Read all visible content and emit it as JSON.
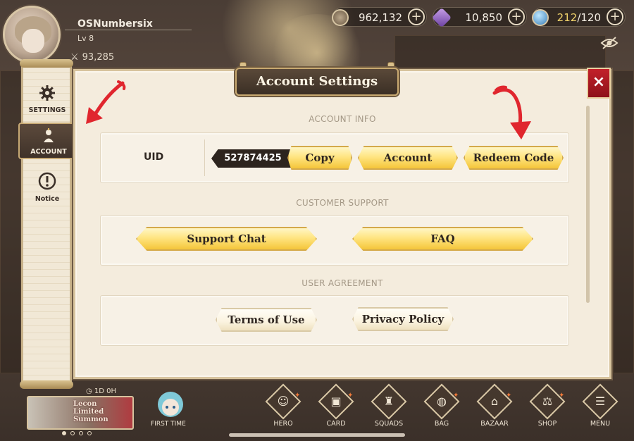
{
  "player": {
    "name": "OSNumbersix",
    "level": "Lv 8",
    "power": "93,285"
  },
  "currencies": {
    "gold": "962,132",
    "gems": "10,850",
    "stamina_current": "212",
    "stamina_max": "/120"
  },
  "sidebar": {
    "tabs": [
      {
        "label": "SETTINGS",
        "icon": "gear-icon"
      },
      {
        "label": "ACCOUNT",
        "icon": "account-icon",
        "active": true
      },
      {
        "label": "Notice",
        "icon": "exclamation-icon"
      }
    ]
  },
  "panel": {
    "title": "Account Settings",
    "close": "×"
  },
  "account_info": {
    "section_label": "ACCOUNT INFO",
    "uid_label": "UID",
    "uid_value": "527874425",
    "copy_button": "Copy",
    "account_button": "Account",
    "redeem_button": "Redeem Code"
  },
  "customer_support": {
    "section_label": "CUSTOMER SUPPORT",
    "support_chat_button": "Support Chat",
    "faq_button": "FAQ"
  },
  "user_agreement": {
    "section_label": "USER AGREEMENT",
    "terms_button": "Terms of Use",
    "privacy_button": "Privacy Policy"
  },
  "bottom": {
    "banner_timer": "1D 0H",
    "banner_text": "Lecon Limited Summon",
    "first_time_label": "FIRST TIME",
    "nav": [
      "HERO",
      "CARD",
      "SQUADS",
      "BAG",
      "BAZAAR",
      "SHOP",
      "MENU"
    ]
  },
  "colors": {
    "accent_red": "#c2212a",
    "button_gold": "#ffe582",
    "panel_bg": "#f4ecdd",
    "annotation_arrow": "#e0262e"
  }
}
